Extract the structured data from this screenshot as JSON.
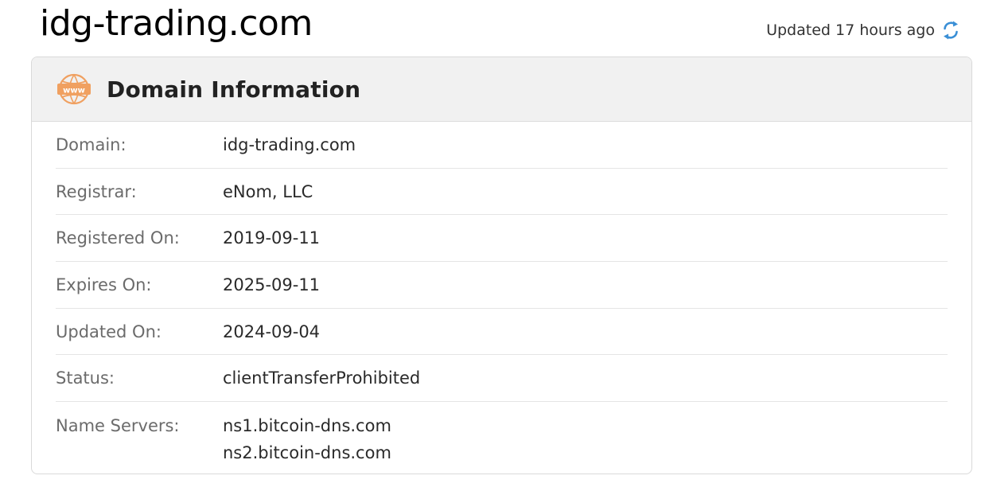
{
  "header": {
    "domain_title": "idg-trading.com",
    "updated_text": "Updated 17 hours ago",
    "refresh_icon": "refresh-icon"
  },
  "card": {
    "icon": "www-globe-icon",
    "title": "Domain Information",
    "rows": [
      {
        "label": "Domain:",
        "value": "idg-trading.com"
      },
      {
        "label": "Registrar:",
        "value": "eNom, LLC"
      },
      {
        "label": "Registered On:",
        "value": "2019-09-11"
      },
      {
        "label": "Expires On:",
        "value": "2025-09-11"
      },
      {
        "label": "Updated On:",
        "value": "2024-09-04"
      },
      {
        "label": "Status:",
        "value": "clientTransferProhibited"
      }
    ],
    "name_servers": {
      "label": "Name Servers:",
      "values": [
        "ns1.bitcoin-dns.com",
        "ns2.bitcoin-dns.com"
      ]
    }
  },
  "colors": {
    "icon_accent": "#f0a060",
    "refresh_accent": "#3a8fd6"
  }
}
